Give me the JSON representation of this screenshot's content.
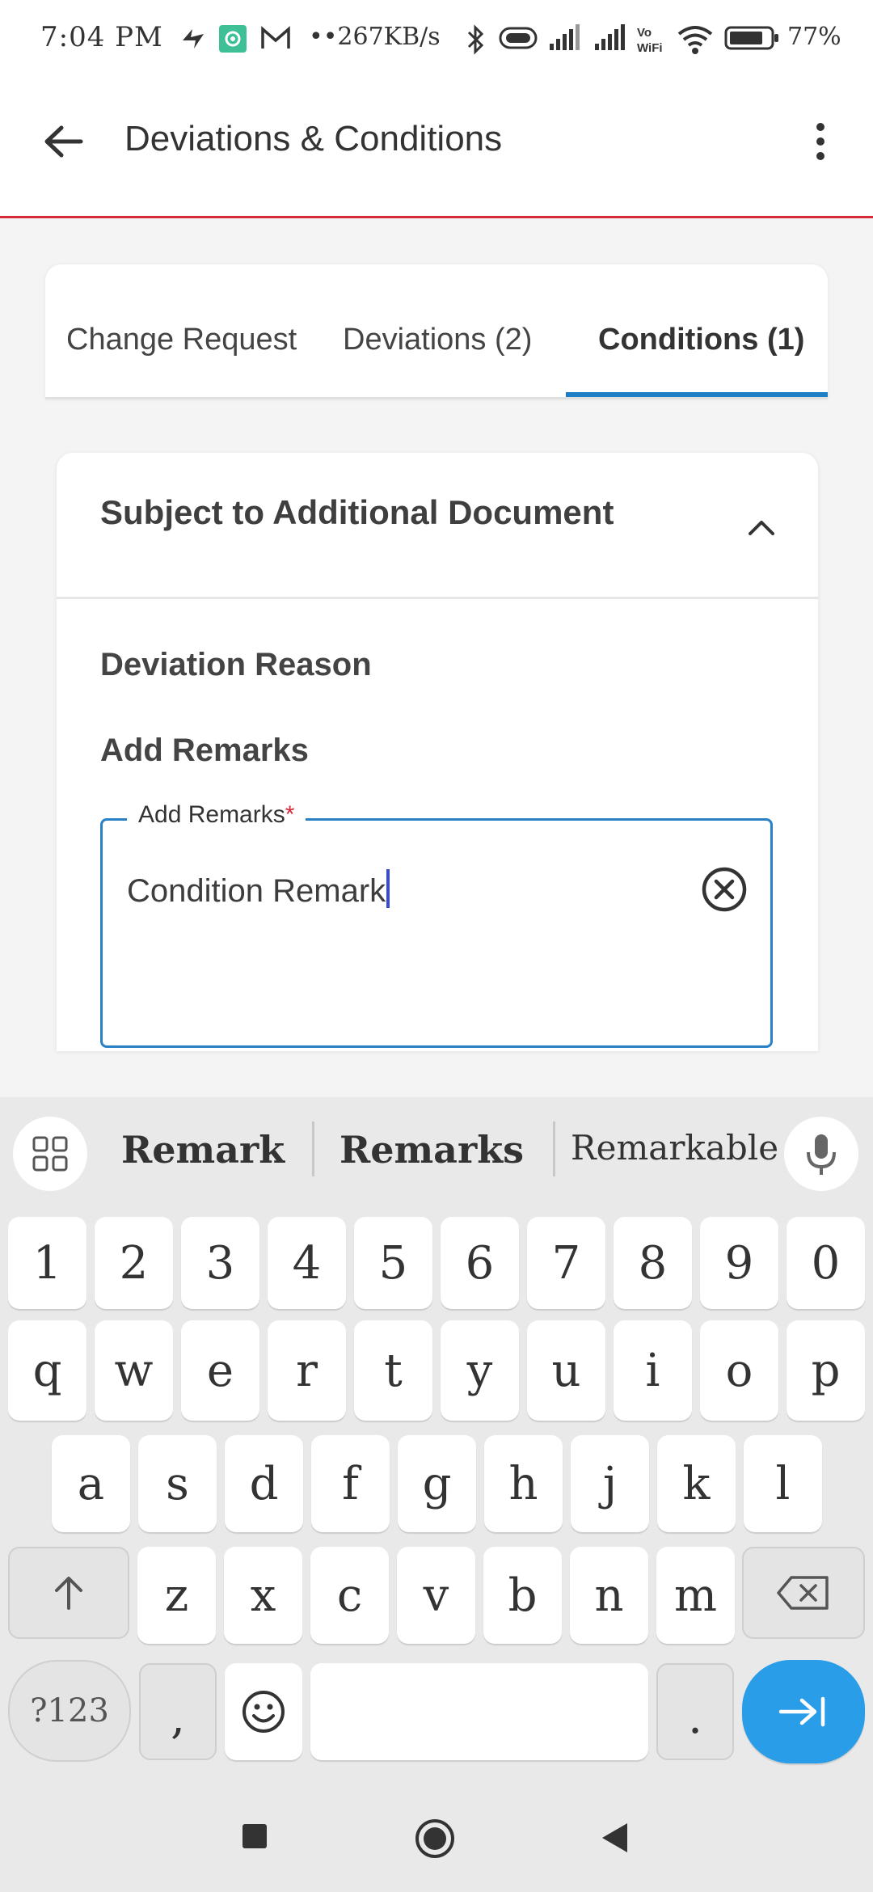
{
  "status_bar": {
    "time": "7:04 PM",
    "network_speed": "••267KB/s",
    "battery_percent": "77%"
  },
  "app_bar": {
    "title": "Deviations & Conditions"
  },
  "tabs": [
    {
      "label": "Change Request",
      "selected": false
    },
    {
      "label": "Deviations (2)",
      "selected": false
    },
    {
      "label": "Conditions (1)",
      "selected": true
    }
  ],
  "accordion": {
    "title": "Subject to Additional Document",
    "expanded": true,
    "deviation_reason_label": "Deviation Reason",
    "add_remarks_label": "Add Remarks",
    "remarks_field": {
      "legend": "Add Remarks",
      "required_mark": "*",
      "value": "Condition Remark"
    }
  },
  "keyboard": {
    "suggestions": [
      "Remark",
      "Remarks",
      "Remarkable"
    ],
    "number_row": [
      "1",
      "2",
      "3",
      "4",
      "5",
      "6",
      "7",
      "8",
      "9",
      "0"
    ],
    "row1": [
      "q",
      "w",
      "e",
      "r",
      "t",
      "y",
      "u",
      "i",
      "o",
      "p"
    ],
    "row2": [
      "a",
      "s",
      "d",
      "f",
      "g",
      "h",
      "j",
      "k",
      "l"
    ],
    "row3": [
      "z",
      "x",
      "c",
      "v",
      "b",
      "n",
      "m"
    ],
    "symbols_label": "?123",
    "comma": ",",
    "period": "."
  },
  "colors": {
    "accent": "#1e7ec6",
    "app_bar_divider": "#d42a3a",
    "enter_key": "#2a9de8",
    "field_border": "#2a80c4"
  }
}
